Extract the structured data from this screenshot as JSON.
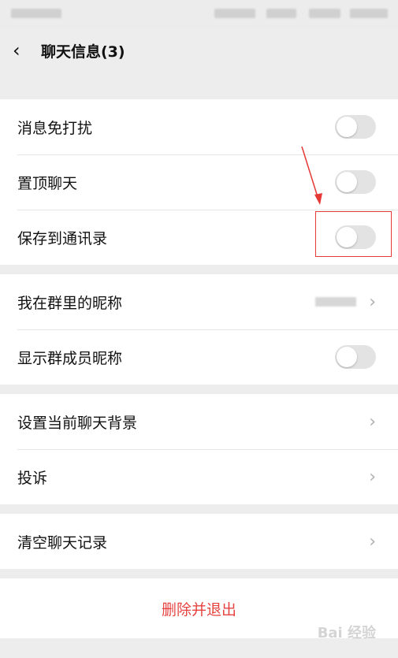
{
  "header": {
    "back_icon": "chevron-left-icon",
    "title": "聊天信息(3)"
  },
  "group1": {
    "items": [
      {
        "label": "消息免打扰",
        "toggle": false
      },
      {
        "label": "置顶聊天",
        "toggle": false
      },
      {
        "label": "保存到通讯录",
        "toggle": false
      }
    ]
  },
  "group2": {
    "items": [
      {
        "label": "我在群里的昵称",
        "chevron": "›"
      },
      {
        "label": "显示群成员昵称",
        "toggle": false
      }
    ]
  },
  "group3": {
    "items": [
      {
        "label": "设置当前聊天背景",
        "chevron": "›"
      },
      {
        "label": "投诉",
        "chevron": "›"
      }
    ]
  },
  "group4": {
    "items": [
      {
        "label": "清空聊天记录",
        "chevron": "›"
      }
    ]
  },
  "actions": {
    "delete_exit": "删除并退出"
  },
  "watermark": "Bai 经验",
  "colors": {
    "danger": "#e64340",
    "annotation": "#e53935"
  }
}
